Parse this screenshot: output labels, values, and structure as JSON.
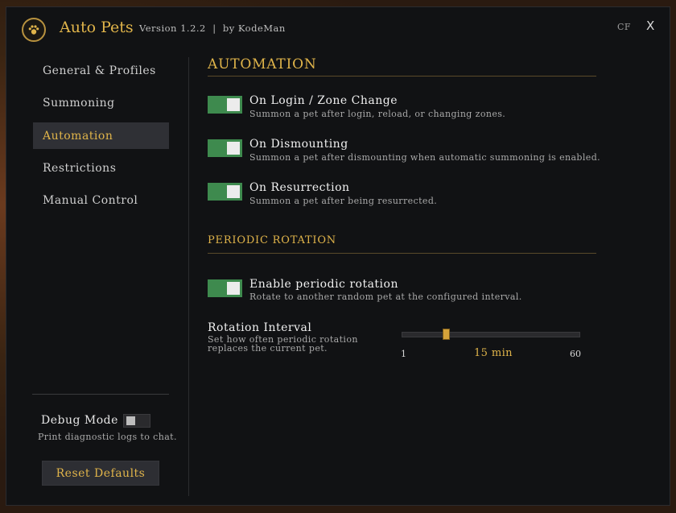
{
  "header": {
    "title": "Auto Pets",
    "version": "Version 1.2.2  |  by KodeMan",
    "cf_label": "CF",
    "close_label": "X",
    "logo_icon": "paw-icon"
  },
  "sidebar": {
    "items": [
      {
        "label": "General & Profiles",
        "active": false
      },
      {
        "label": "Summoning",
        "active": false
      },
      {
        "label": "Automation",
        "active": true
      },
      {
        "label": "Restrictions",
        "active": false
      },
      {
        "label": "Manual Control",
        "active": false
      }
    ],
    "debug": {
      "label": "Debug Mode",
      "description": "Print diagnostic logs to chat.",
      "enabled": false
    },
    "reset_label": "Reset Defaults"
  },
  "main": {
    "section_title": "AUTOMATION",
    "options": [
      {
        "label": "On Login / Zone Change",
        "description": "Summon a pet after login, reload, or changing zones.",
        "enabled": true
      },
      {
        "label": "On Dismounting",
        "description": "Summon a pet after dismounting when automatic summoning is enabled.",
        "enabled": true
      },
      {
        "label": "On Resurrection",
        "description": "Summon a pet after being resurrected.",
        "enabled": true
      }
    ],
    "periodic": {
      "section_title": "PERIODIC ROTATION",
      "option": {
        "label": "Enable periodic rotation",
        "description": "Rotate to another random pet at the configured interval.",
        "enabled": true
      },
      "interval": {
        "label": "Rotation Interval",
        "description": "Set how often periodic rotation replaces the current pet.",
        "min": 1,
        "max": 60,
        "value": 15,
        "value_label": "15 min",
        "min_label": "1",
        "max_label": "60"
      }
    }
  },
  "colors": {
    "accent": "#e0b44a",
    "toggle_on": "#3e8a4e",
    "active_nav_bg": "#2f3035",
    "window_bg": "#111214"
  }
}
